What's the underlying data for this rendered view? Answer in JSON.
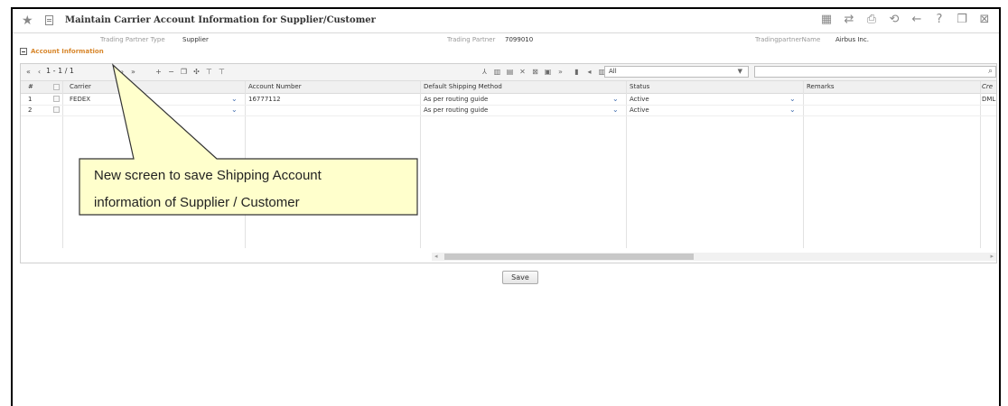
{
  "header": {
    "title": "Maintain Carrier Account Information for Supplier/Customer",
    "toolbar_icons": [
      "grid-icon",
      "shuffle-icon",
      "print-icon",
      "sync-icon",
      "back-icon",
      "help-icon",
      "window-icon",
      "close-window-icon"
    ]
  },
  "info": {
    "type_label": "Trading Partner Type",
    "type_value": "Supplier",
    "partner_label": "Trading Partner",
    "partner_value": "7099010",
    "name_label": "TradingpartnerName",
    "name_value": "Airbus Inc."
  },
  "section": {
    "title": "Account Information"
  },
  "grid": {
    "pager": "1 - 1 / 1",
    "filter_value": "All",
    "columns": [
      "#",
      "Carrier",
      "Account Number",
      "Default Shipping Method",
      "Status",
      "Remarks",
      "Cre"
    ],
    "rows": [
      {
        "num": "1",
        "carrier": "FEDEX",
        "account": "16777112",
        "method": "As per routing guide",
        "status": "Active",
        "remarks": "",
        "cre": "DML"
      },
      {
        "num": "2",
        "carrier": "",
        "account": "",
        "method": "As per routing guide",
        "status": "Active",
        "remarks": "",
        "cre": ""
      }
    ]
  },
  "save_label": "Save",
  "callout": {
    "line1": "New screen to save Shipping Account",
    "line2": "information of Supplier / Customer",
    "fill": "#ffffcc",
    "border": "#333333"
  }
}
